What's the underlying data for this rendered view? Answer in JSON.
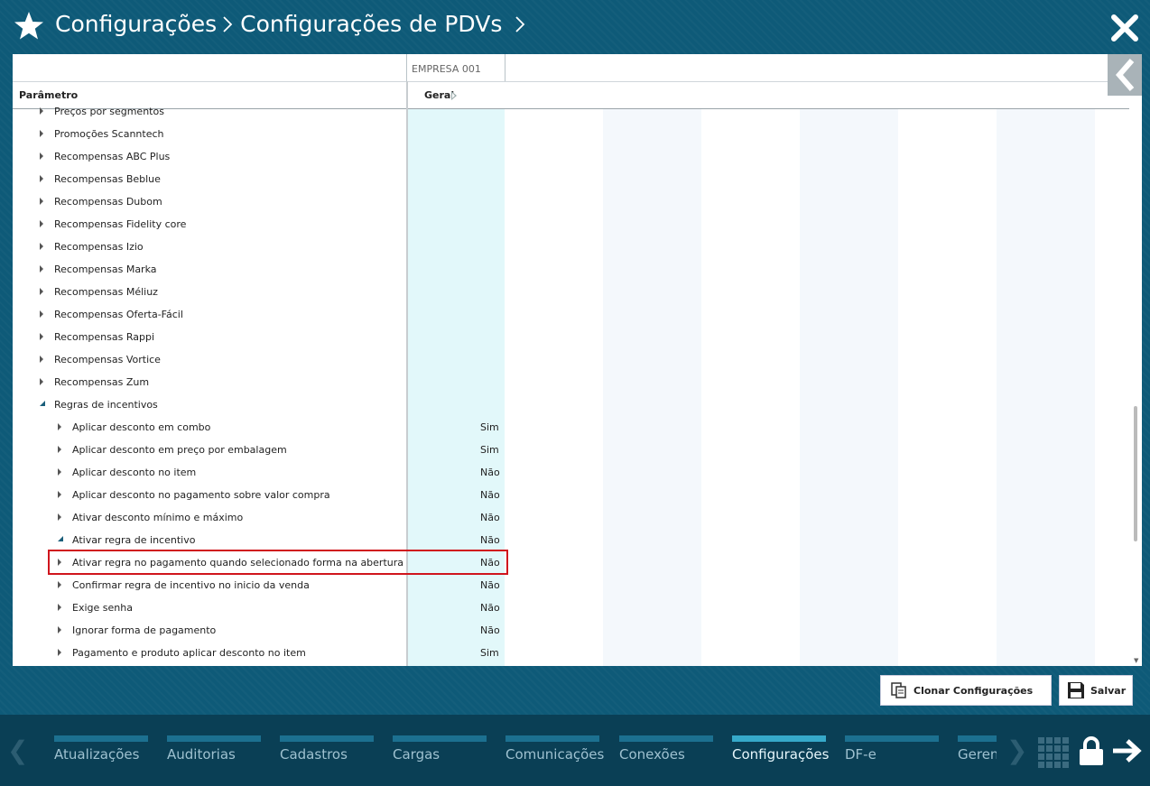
{
  "header": {
    "icon": "star-icon",
    "crumb1": "Configurações",
    "crumb2": "Configurações de PDVs",
    "close_icon": "close-icon"
  },
  "grid": {
    "column_group": "EMPRESA 001",
    "param_header": "Parâmetro",
    "geral_header": "Geral",
    "rows": [
      {
        "label": "Preços por segmentos",
        "value": "",
        "level": 0,
        "state": "collapsed"
      },
      {
        "label": "Promoções Scanntech",
        "value": "",
        "level": 0,
        "state": "collapsed"
      },
      {
        "label": "Recompensas ABC Plus",
        "value": "",
        "level": 0,
        "state": "collapsed"
      },
      {
        "label": "Recompensas Beblue",
        "value": "",
        "level": 0,
        "state": "collapsed"
      },
      {
        "label": "Recompensas Dubom",
        "value": "",
        "level": 0,
        "state": "collapsed"
      },
      {
        "label": "Recompensas Fidelity core",
        "value": "",
        "level": 0,
        "state": "collapsed"
      },
      {
        "label": "Recompensas Izio",
        "value": "",
        "level": 0,
        "state": "collapsed"
      },
      {
        "label": "Recompensas Marka",
        "value": "",
        "level": 0,
        "state": "collapsed"
      },
      {
        "label": "Recompensas Méliuz",
        "value": "",
        "level": 0,
        "state": "collapsed"
      },
      {
        "label": "Recompensas Oferta-Fácil",
        "value": "",
        "level": 0,
        "state": "collapsed"
      },
      {
        "label": "Recompensas Rappi",
        "value": "",
        "level": 0,
        "state": "collapsed"
      },
      {
        "label": "Recompensas Vortice",
        "value": "",
        "level": 0,
        "state": "collapsed"
      },
      {
        "label": "Recompensas Zum",
        "value": "",
        "level": 0,
        "state": "collapsed"
      },
      {
        "label": "Regras de incentivos",
        "value": "",
        "level": 0,
        "state": "expanded"
      },
      {
        "label": "Aplicar desconto em combo",
        "value": "Sim",
        "level": 1,
        "state": "collapsed"
      },
      {
        "label": "Aplicar desconto em preço por embalagem",
        "value": "Sim",
        "level": 1,
        "state": "collapsed"
      },
      {
        "label": "Aplicar desconto no item",
        "value": "Não",
        "level": 1,
        "state": "collapsed"
      },
      {
        "label": "Aplicar desconto no pagamento sobre valor compra",
        "value": "Não",
        "level": 1,
        "state": "collapsed"
      },
      {
        "label": "Ativar desconto mínimo e máximo",
        "value": "Não",
        "level": 1,
        "state": "collapsed"
      },
      {
        "label": "Ativar regra de incentivo",
        "value": "Não",
        "level": 1,
        "state": "expanded"
      },
      {
        "label": "Ativar regra no pagamento quando selecionado forma na abertura",
        "value": "Não",
        "level": 1,
        "state": "collapsed"
      },
      {
        "label": "Confirmar regra de incentivo no inicio da venda",
        "value": "Não",
        "level": 1,
        "state": "collapsed"
      },
      {
        "label": "Exige senha",
        "value": "Não",
        "level": 1,
        "state": "collapsed"
      },
      {
        "label": "Ignorar forma de pagamento",
        "value": "Não",
        "level": 1,
        "state": "collapsed"
      },
      {
        "label": "Pagamento e produto aplicar desconto no item",
        "value": "Sim",
        "level": 1,
        "state": "collapsed"
      }
    ]
  },
  "actions": {
    "clone_label": "Clonar Configurações",
    "save_label": "Salvar"
  },
  "bottom_nav": {
    "tabs": [
      {
        "label": "Atualizações",
        "active": false
      },
      {
        "label": "Auditorias",
        "active": false
      },
      {
        "label": "Cadastros",
        "active": false
      },
      {
        "label": "Cargas",
        "active": false
      },
      {
        "label": "Comunicações",
        "active": false
      },
      {
        "label": "Conexões",
        "active": false
      },
      {
        "label": "Configurações",
        "active": true
      },
      {
        "label": "DF-e",
        "active": false
      },
      {
        "label": "Gerenciamento",
        "active": false
      }
    ]
  },
  "colors": {
    "background": "#0e5a78",
    "bottom_bar": "#0a3f55",
    "active_tab": "#36a9c9",
    "highlight_border": "#d0151d",
    "geral_column": "#e2f8fa"
  }
}
